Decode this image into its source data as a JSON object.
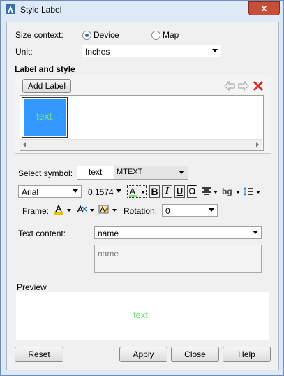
{
  "window": {
    "title": "Style Label",
    "close_glyph": "x"
  },
  "size_context": {
    "label": "Size context:",
    "options": [
      "Device",
      "Map"
    ],
    "selected": "Device"
  },
  "unit": {
    "label": "Unit:",
    "value": "Inches"
  },
  "label_style": {
    "heading": "Label and style",
    "add_label_button": "Add Label",
    "icons": [
      "arrow-left-icon",
      "arrow-right-icon",
      "delete-icon"
    ],
    "thumbnail_text": "text",
    "thumbnail_color": "#3399ff",
    "thumbnail_text_color": "#7fe07f"
  },
  "select_symbol": {
    "label": "Select symbol:",
    "symbol_text": "text",
    "type_value": "MTEXT"
  },
  "format": {
    "font": "Arial",
    "size": "0.1574",
    "color_button_glyph": "A",
    "bold": "B",
    "italic": "I",
    "underline": "U",
    "overline": "O",
    "background_glyph": "bg",
    "icons": [
      "align-icon",
      "line-spacing-icon"
    ]
  },
  "frame": {
    "label": "Frame:",
    "icons": [
      "font-color-icon",
      "frame-style-icon",
      "frame-color-icon"
    ]
  },
  "rotation": {
    "label": "Rotation:",
    "value": "0"
  },
  "text_content": {
    "label": "Text content:",
    "value": "name",
    "preview_value": "name"
  },
  "preview": {
    "label": "Preview",
    "text": "text",
    "text_color": "#7fe07f"
  },
  "buttons": {
    "reset": "Reset",
    "apply": "Apply",
    "close": "Close",
    "help": "Help"
  }
}
